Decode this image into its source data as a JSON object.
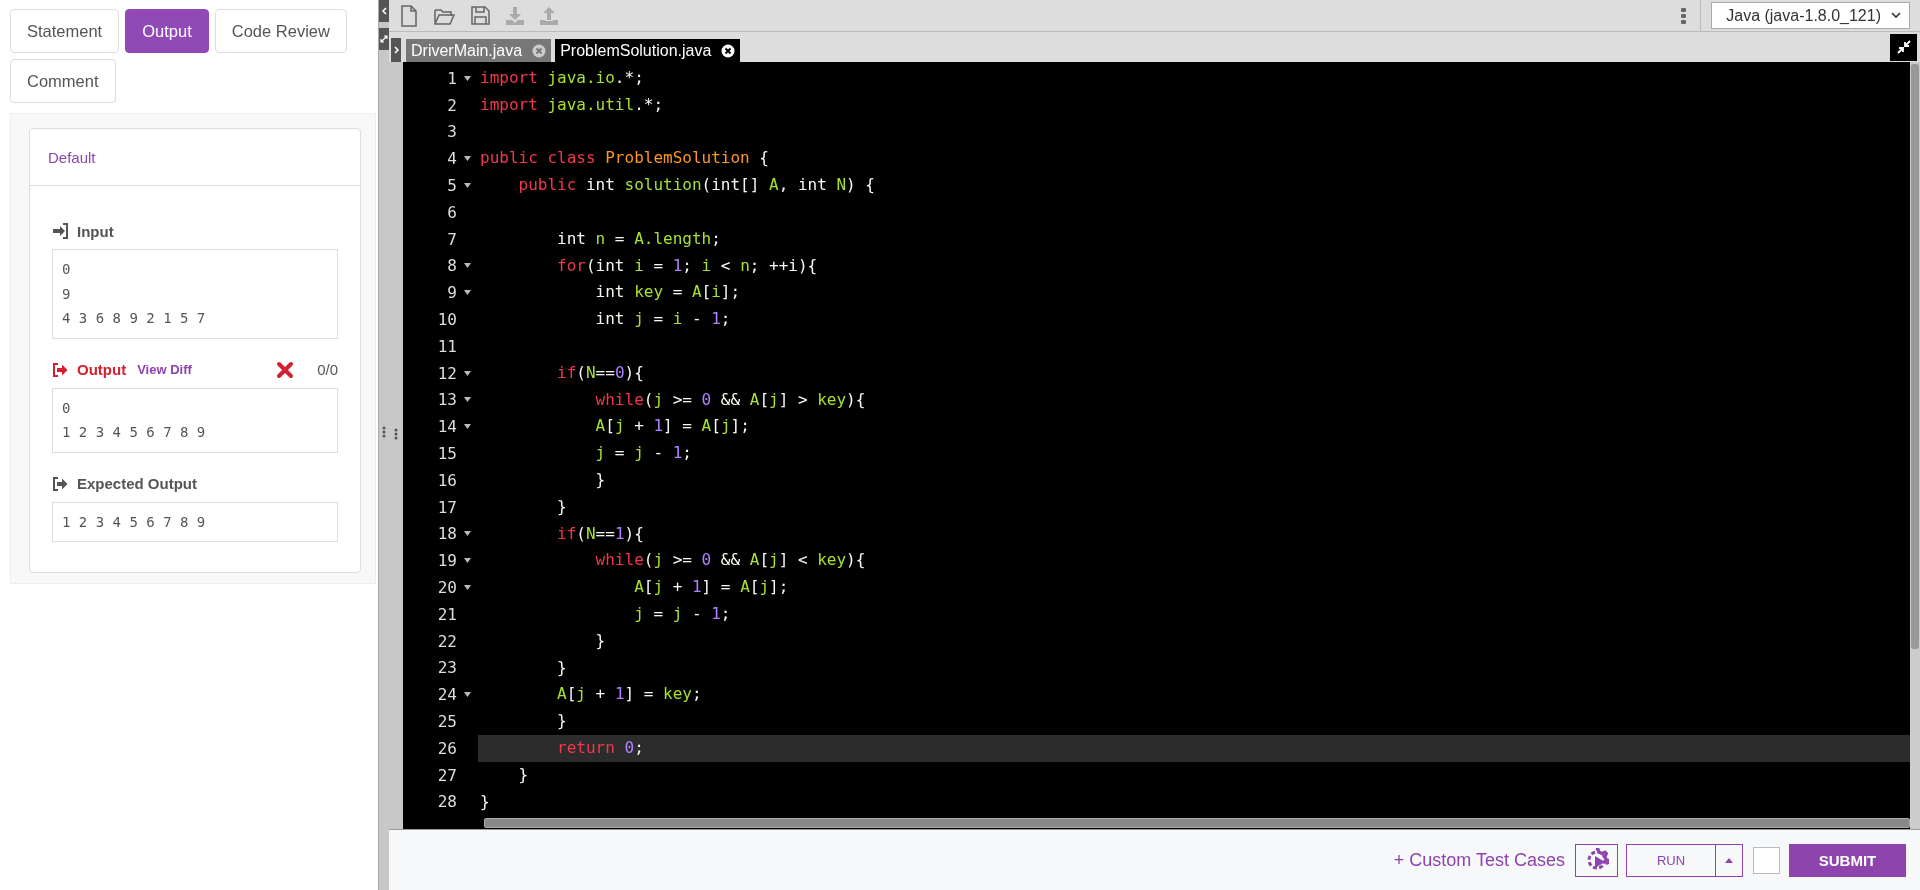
{
  "tabs": [
    {
      "label": "Statement",
      "selected": false
    },
    {
      "label": "Output",
      "selected": true
    },
    {
      "label": "Code Review",
      "selected": false
    },
    {
      "label": "Comment",
      "selected": false
    }
  ],
  "result": {
    "title": "Default",
    "sections": [
      {
        "kind": "input",
        "heading": "Input",
        "lines": [
          "0",
          "9",
          "4 3 6 8 9 2 1 5 7"
        ]
      },
      {
        "kind": "output",
        "heading": "Output",
        "link": "View Diff",
        "passed": false,
        "score": "0/0",
        "lines": [
          "0",
          "1 2 3 4 5 6 7 8 9"
        ]
      },
      {
        "kind": "expected",
        "heading": "Expected Output",
        "lines": [
          "1 2 3 4 5 6 7 8 9"
        ]
      }
    ]
  },
  "editor": {
    "language": "Java (java-1.8.0_121)",
    "files": [
      {
        "name": "DriverMain.java",
        "selected": false
      },
      {
        "name": "ProblemSolution.java",
        "selected": true
      }
    ],
    "lines": [
      {
        "number": "1",
        "foldable": true,
        "active": false,
        "tokens": [
          {
            "kind": "kw",
            "text": "import"
          },
          {
            "kind": "var",
            "text": " java.io"
          },
          {
            "kind": "plain",
            "text": ".*;"
          }
        ]
      },
      {
        "number": "2",
        "foldable": false,
        "active": false,
        "tokens": [
          {
            "kind": "kw",
            "text": "import"
          },
          {
            "kind": "var",
            "text": " java.util"
          },
          {
            "kind": "plain",
            "text": ".*;"
          }
        ]
      },
      {
        "number": "3",
        "foldable": false,
        "active": false
      },
      {
        "number": "4",
        "foldable": true,
        "active": false,
        "tokens": [
          {
            "kind": "kw",
            "text": "public class"
          },
          {
            "kind": "cls",
            "text": " ProblemSolution"
          },
          {
            "kind": "plain",
            "text": " {"
          }
        ]
      },
      {
        "number": "5",
        "foldable": true,
        "active": false,
        "tokens": [
          {
            "kind": "kw",
            "text": "    public"
          },
          {
            "kind": "plain",
            "text": " int "
          },
          {
            "kind": "var",
            "text": "solution"
          },
          {
            "kind": "plain",
            "text": "(int[] "
          },
          {
            "kind": "var",
            "text": "A"
          },
          {
            "kind": "plain",
            "text": ", int "
          },
          {
            "kind": "var",
            "text": "N"
          },
          {
            "kind": "plain",
            "text": ") {"
          }
        ]
      },
      {
        "number": "6",
        "foldable": false,
        "active": false
      },
      {
        "number": "7",
        "foldable": false,
        "active": false,
        "tokens": [
          {
            "kind": "plain",
            "text": "        int "
          },
          {
            "kind": "var",
            "text": "n"
          },
          {
            "kind": "plain",
            "text": " = "
          },
          {
            "kind": "var",
            "text": "A.length"
          },
          {
            "kind": "plain",
            "text": ";"
          }
        ]
      },
      {
        "number": "8",
        "foldable": true,
        "active": false,
        "tokens": [
          {
            "kind": "kw",
            "text": "        for"
          },
          {
            "kind": "plain",
            "text": "(int "
          },
          {
            "kind": "var",
            "text": "i"
          },
          {
            "kind": "plain",
            "text": " = "
          },
          {
            "kind": "num",
            "text": "1"
          },
          {
            "kind": "plain",
            "text": "; "
          },
          {
            "kind": "var",
            "text": "i"
          },
          {
            "kind": "plain",
            "text": " < "
          },
          {
            "kind": "var",
            "text": "n"
          },
          {
            "kind": "plain",
            "text": "; ++i){"
          }
        ]
      },
      {
        "number": "9",
        "foldable": true,
        "active": false,
        "tokens": [
          {
            "kind": "plain",
            "text": "            int "
          },
          {
            "kind": "var",
            "text": "key"
          },
          {
            "kind": "plain",
            "text": " = "
          },
          {
            "kind": "var",
            "text": "A"
          },
          {
            "kind": "plain",
            "text": "["
          },
          {
            "kind": "var",
            "text": "i"
          },
          {
            "kind": "plain",
            "text": "];"
          }
        ]
      },
      {
        "number": "10",
        "foldable": false,
        "active": false,
        "tokens": [
          {
            "kind": "plain",
            "text": "            int "
          },
          {
            "kind": "var",
            "text": "j"
          },
          {
            "kind": "plain",
            "text": " = "
          },
          {
            "kind": "var",
            "text": "i"
          },
          {
            "kind": "plain",
            "text": " - "
          },
          {
            "kind": "num",
            "text": "1"
          },
          {
            "kind": "plain",
            "text": ";"
          }
        ]
      },
      {
        "number": "11",
        "foldable": false,
        "active": false
      },
      {
        "number": "12",
        "foldable": true,
        "active": false,
        "tokens": [
          {
            "kind": "kw",
            "text": "        if"
          },
          {
            "kind": "plain",
            "text": "("
          },
          {
            "kind": "var",
            "text": "N"
          },
          {
            "kind": "plain",
            "text": "=="
          },
          {
            "kind": "num",
            "text": "0"
          },
          {
            "kind": "plain",
            "text": "){"
          }
        ]
      },
      {
        "number": "13",
        "foldable": true,
        "active": false,
        "tokens": [
          {
            "kind": "kw",
            "text": "            while"
          },
          {
            "kind": "plain",
            "text": "("
          },
          {
            "kind": "var",
            "text": "j"
          },
          {
            "kind": "plain",
            "text": " >= "
          },
          {
            "kind": "num",
            "text": "0"
          },
          {
            "kind": "plain",
            "text": " && "
          },
          {
            "kind": "var",
            "text": "A"
          },
          {
            "kind": "plain",
            "text": "["
          },
          {
            "kind": "var",
            "text": "j"
          },
          {
            "kind": "plain",
            "text": "] > "
          },
          {
            "kind": "var",
            "text": "key"
          },
          {
            "kind": "plain",
            "text": "){"
          }
        ]
      },
      {
        "number": "14",
        "foldable": true,
        "active": false,
        "tokens": [
          {
            "kind": "var",
            "text": "            A"
          },
          {
            "kind": "plain",
            "text": "["
          },
          {
            "kind": "var",
            "text": "j"
          },
          {
            "kind": "plain",
            "text": " + "
          },
          {
            "kind": "num",
            "text": "1"
          },
          {
            "kind": "plain",
            "text": "] = "
          },
          {
            "kind": "var",
            "text": "A"
          },
          {
            "kind": "plain",
            "text": "["
          },
          {
            "kind": "var",
            "text": "j"
          },
          {
            "kind": "plain",
            "text": "];"
          }
        ]
      },
      {
        "number": "15",
        "foldable": false,
        "active": false,
        "tokens": [
          {
            "kind": "var",
            "text": "            j"
          },
          {
            "kind": "plain",
            "text": " = "
          },
          {
            "kind": "var",
            "text": "j"
          },
          {
            "kind": "plain",
            "text": " - "
          },
          {
            "kind": "num",
            "text": "1"
          },
          {
            "kind": "plain",
            "text": ";"
          }
        ]
      },
      {
        "number": "16",
        "foldable": false,
        "active": false,
        "tokens": [
          {
            "kind": "plain",
            "text": "            }"
          }
        ]
      },
      {
        "number": "17",
        "foldable": false,
        "active": false,
        "tokens": [
          {
            "kind": "plain",
            "text": "        }"
          }
        ]
      },
      {
        "number": "18",
        "foldable": true,
        "active": false,
        "tokens": [
          {
            "kind": "kw",
            "text": "        if"
          },
          {
            "kind": "plain",
            "text": "("
          },
          {
            "kind": "var",
            "text": "N"
          },
          {
            "kind": "plain",
            "text": "=="
          },
          {
            "kind": "num",
            "text": "1"
          },
          {
            "kind": "plain",
            "text": "){"
          }
        ]
      },
      {
        "number": "19",
        "foldable": true,
        "active": false,
        "tokens": [
          {
            "kind": "kw",
            "text": "            while"
          },
          {
            "kind": "plain",
            "text": "("
          },
          {
            "kind": "var",
            "text": "j"
          },
          {
            "kind": "plain",
            "text": " >= "
          },
          {
            "kind": "num",
            "text": "0"
          },
          {
            "kind": "plain",
            "text": " && "
          },
          {
            "kind": "var",
            "text": "A"
          },
          {
            "kind": "plain",
            "text": "["
          },
          {
            "kind": "var",
            "text": "j"
          },
          {
            "kind": "plain",
            "text": "] < "
          },
          {
            "kind": "var",
            "text": "key"
          },
          {
            "kind": "plain",
            "text": "){"
          }
        ]
      },
      {
        "number": "20",
        "foldable": true,
        "active": false,
        "tokens": [
          {
            "kind": "var",
            "text": "                A"
          },
          {
            "kind": "plain",
            "text": "["
          },
          {
            "kind": "var",
            "text": "j"
          },
          {
            "kind": "plain",
            "text": " + "
          },
          {
            "kind": "num",
            "text": "1"
          },
          {
            "kind": "plain",
            "text": "] = "
          },
          {
            "kind": "var",
            "text": "A"
          },
          {
            "kind": "plain",
            "text": "["
          },
          {
            "kind": "var",
            "text": "j"
          },
          {
            "kind": "plain",
            "text": "];"
          }
        ]
      },
      {
        "number": "21",
        "foldable": false,
        "active": false,
        "tokens": [
          {
            "kind": "var",
            "text": "                j"
          },
          {
            "kind": "plain",
            "text": " = "
          },
          {
            "kind": "var",
            "text": "j"
          },
          {
            "kind": "plain",
            "text": " - "
          },
          {
            "kind": "num",
            "text": "1"
          },
          {
            "kind": "plain",
            "text": ";"
          }
        ]
      },
      {
        "number": "22",
        "foldable": false,
        "active": false,
        "tokens": [
          {
            "kind": "plain",
            "text": "            }"
          }
        ]
      },
      {
        "number": "23",
        "foldable": false,
        "active": false,
        "tokens": [
          {
            "kind": "plain",
            "text": "        }"
          }
        ]
      },
      {
        "number": "24",
        "foldable": true,
        "active": false,
        "tokens": [
          {
            "kind": "var",
            "text": "        A"
          },
          {
            "kind": "plain",
            "text": "["
          },
          {
            "kind": "var",
            "text": "j"
          },
          {
            "kind": "plain",
            "text": " + "
          },
          {
            "kind": "num",
            "text": "1"
          },
          {
            "kind": "plain",
            "text": "] = "
          },
          {
            "kind": "var",
            "text": "key"
          },
          {
            "kind": "plain",
            "text": ";"
          }
        ]
      },
      {
        "number": "25",
        "foldable": false,
        "active": false,
        "tokens": [
          {
            "kind": "plain",
            "text": "        }"
          }
        ]
      },
      {
        "number": "26",
        "foldable": false,
        "active": true,
        "tokens": [
          {
            "kind": "kw",
            "text": "        return"
          },
          {
            "kind": "num",
            "text": " 0"
          },
          {
            "kind": "plain",
            "text": ";"
          }
        ]
      },
      {
        "number": "27",
        "foldable": false,
        "active": false,
        "tokens": [
          {
            "kind": "plain",
            "text": "    }"
          }
        ]
      },
      {
        "number": "28",
        "foldable": false,
        "active": false,
        "tokens": [
          {
            "kind": "plain",
            "text": "}"
          }
        ]
      }
    ]
  },
  "actions": {
    "custom_tests": "+ Custom Test Cases",
    "run": "RUN",
    "checked": false,
    "submit": "SUBMIT"
  }
}
